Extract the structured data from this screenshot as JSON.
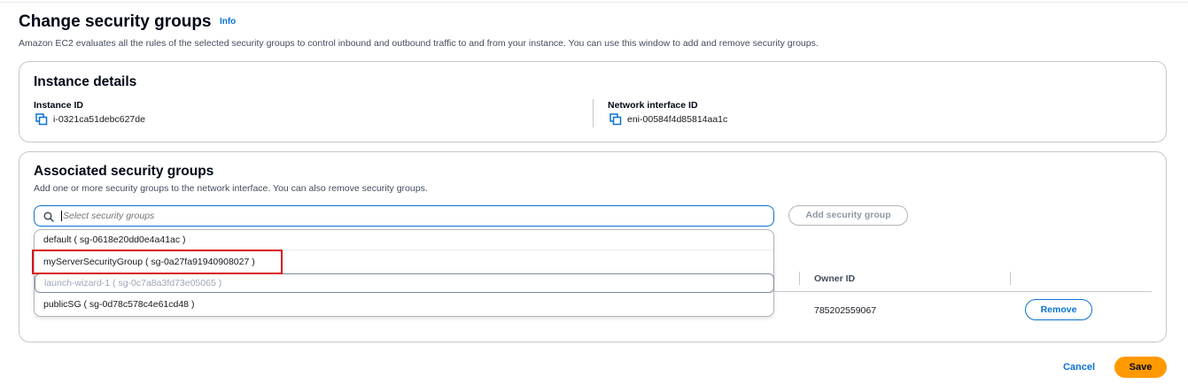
{
  "page": {
    "title": "Change security groups",
    "info_label": "Info",
    "description": "Amazon EC2 evaluates all the rules of the selected security groups to control inbound and outbound traffic to and from your instance. You can use this window to add and remove security groups."
  },
  "instance_details": {
    "title": "Instance details",
    "instance_id_label": "Instance ID",
    "instance_id_value": "i-0321ca51debc627de",
    "network_interface_label": "Network interface ID",
    "network_interface_value": "eni-00584f4d85814aa1c"
  },
  "security_groups": {
    "title": "Associated security groups",
    "description": "Add one or more security groups to the network interface. You can also remove security groups.",
    "search_placeholder": "Select security groups",
    "add_button": "Add security group",
    "options": [
      "default ( sg-0618e20dd0e4a41ac )",
      "myServerSecurityGroup ( sg-0a27fa91940908027 )",
      "launch-wizard-1 ( sg-0c7a8a3fd73e05065 )",
      "publicSG ( sg-0d78c578c4e61cd48 )"
    ],
    "table": {
      "owner_header": "Owner ID",
      "owner_value": "785202559067",
      "remove_button": "Remove"
    }
  },
  "footer": {
    "cancel_label": "Cancel",
    "save_label": "Save"
  },
  "colors": {
    "link": "#0972d3",
    "primary_button": "#ff9900",
    "highlight": "#d91515"
  }
}
